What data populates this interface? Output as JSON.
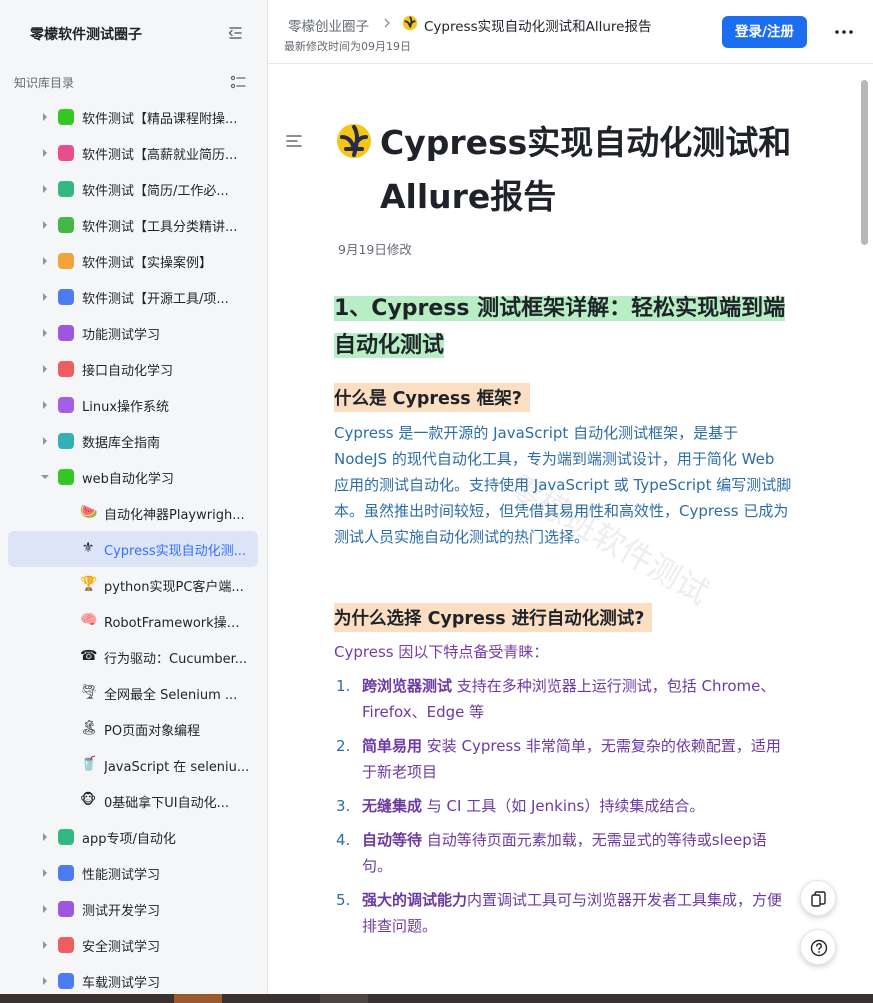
{
  "sidebar": {
    "title": "零檬软件测试圈子",
    "section_label": "知识库目录",
    "items": [
      {
        "label": "软件测试【精品课程附操...",
        "color": "#34c724"
      },
      {
        "label": "软件测试【高薪就业简历...",
        "color": "#e94d8a"
      },
      {
        "label": "软件测试【简历/工作必...",
        "color": "#34b87f"
      },
      {
        "label": "软件测试【工具分类精讲...",
        "color": "#45b648"
      },
      {
        "label": "软件测试【实操案例】",
        "color": "#f2a33a"
      },
      {
        "label": "软件测试【开源工具/项...",
        "color": "#4c7bf4"
      },
      {
        "label": "功能测试学习",
        "color": "#9a58e0"
      },
      {
        "label": "接口自动化学习",
        "color": "#ee5e5e"
      },
      {
        "label": "Linux操作系统",
        "color": "#a55ee6"
      },
      {
        "label": "数据库全指南",
        "color": "#33b0b8"
      },
      {
        "label": "web自动化学习",
        "color": "#34c724"
      }
    ],
    "children": [
      {
        "label": "自动化神器Playwrigh...",
        "emoji": "🍉"
      },
      {
        "label": "Cypress实现自动化测...",
        "emoji": "⚜",
        "active": true
      },
      {
        "label": "python实现PC客户端...",
        "emoji": "🏆"
      },
      {
        "label": "RobotFramework操作...",
        "emoji": "🧠"
      },
      {
        "label": "行为驱动：Cucumber...",
        "emoji": "☎"
      },
      {
        "label": "全网最全 Selenium ...",
        "emoji": "🌪"
      },
      {
        "label": "PO页面对象编程",
        "emoji": "🏝"
      },
      {
        "label": "JavaScript 在 seleniu...",
        "emoji": "🥤"
      },
      {
        "label": "0基础拿下UI自动化...",
        "emoji": "🐵"
      }
    ],
    "items_after": [
      {
        "label": "app专项/自动化",
        "color": "#34b87f"
      },
      {
        "label": "性能测试学习",
        "color": "#4c7bf4"
      },
      {
        "label": "测试开发学习",
        "color": "#9a58e0"
      },
      {
        "label": "安全测试学习",
        "color": "#ee5e5e"
      },
      {
        "label": "车载测试学习",
        "color": "#4c7bf4"
      }
    ]
  },
  "header": {
    "breadcrumb_space": "零檬创业圈子",
    "breadcrumb_doc": "Cypress实现自动化测试和Allure报告",
    "modified": "最新修改时间为09月19日",
    "login_label": "登录/注册"
  },
  "doc": {
    "title": "Cypress实现自动化测试和Allure报告",
    "date": "9月19日修改",
    "h1": "1、Cypress 测试框架详解：轻松实现端到端自动化测试",
    "h2_what": "什么是 Cypress 框架?",
    "para_what": "Cypress 是一款开源的 JavaScript 自动化测试框架，是基于 NodeJS 的现代自动化工具，专为端到端测试设计，用于简化 Web 应用的测试自动化。支持使用 JavaScript 或 TypeScript 编写测试脚本。虽然推出时间较短，但凭借其易用性和高效性，Cypress 已成为测试人员实施自动化测试的热门选择。",
    "h2_why": "为什么选择 Cypress 进行自动化测试?",
    "intro_why": "Cypress 因以下特点备受青睐：",
    "list": [
      {
        "num": "1.",
        "bold": "跨浏览器测试",
        "text": " 支持在多种浏览器上运行测试，包括 Chrome、Firefox、Edge 等"
      },
      {
        "num": "2.",
        "bold": "简单易用",
        "text": " 安装 Cypress 非常简单，无需复杂的依赖配置，适用于新老项目"
      },
      {
        "num": "3.",
        "bold": "无缝集成",
        "text": " 与 CI 工具（如 Jenkins）持续集成结合。"
      },
      {
        "num": "4.",
        "bold": "自动等待",
        "text": " 自动等待页面元素加载，无需显式的等待或sleep语句。"
      },
      {
        "num": "5.",
        "bold": "强大的调试能力",
        "text": "内置调试工具可与浏览器开发者工具集成，方便排查问题。"
      }
    ],
    "watermark": "零檬班软件测试"
  }
}
